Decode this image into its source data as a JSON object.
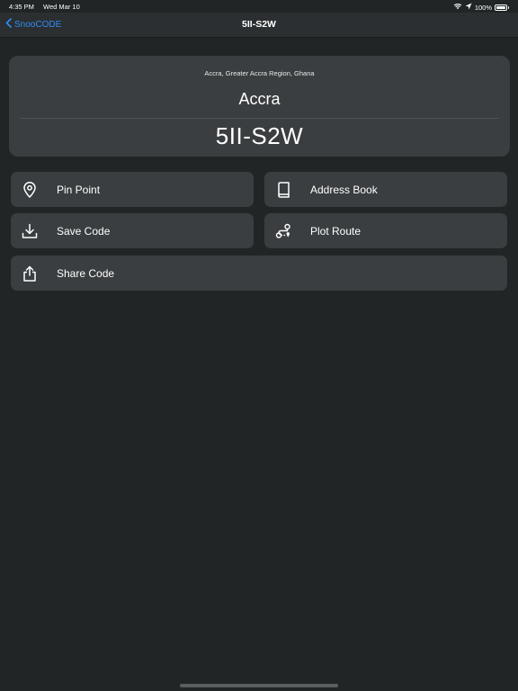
{
  "status_bar": {
    "time": "4:35 PM",
    "date": "Wed Mar 10",
    "battery": "100%",
    "battery_level": 1.0,
    "icons": [
      "wifi-icon",
      "location-arrow-icon",
      "battery-icon"
    ]
  },
  "nav": {
    "back_label": "SnooCODE",
    "back_icon": "chevron-left-icon",
    "title": "5II-S2W",
    "accent_color": "#2f8cf5"
  },
  "card": {
    "location": "Accra, Greater Accra Region, Ghana",
    "city": "Accra",
    "code": "5II-S2W"
  },
  "actions": {
    "pin_point": {
      "label": "Pin Point",
      "icon": "map-pin-icon"
    },
    "address_book": {
      "label": "Address Book",
      "icon": "book-icon"
    },
    "save_code": {
      "label": "Save Code",
      "icon": "download-icon"
    },
    "plot_route": {
      "label": "Plot Route",
      "icon": "route-icon"
    },
    "share_code": {
      "label": "Share Code",
      "icon": "share-icon"
    }
  }
}
